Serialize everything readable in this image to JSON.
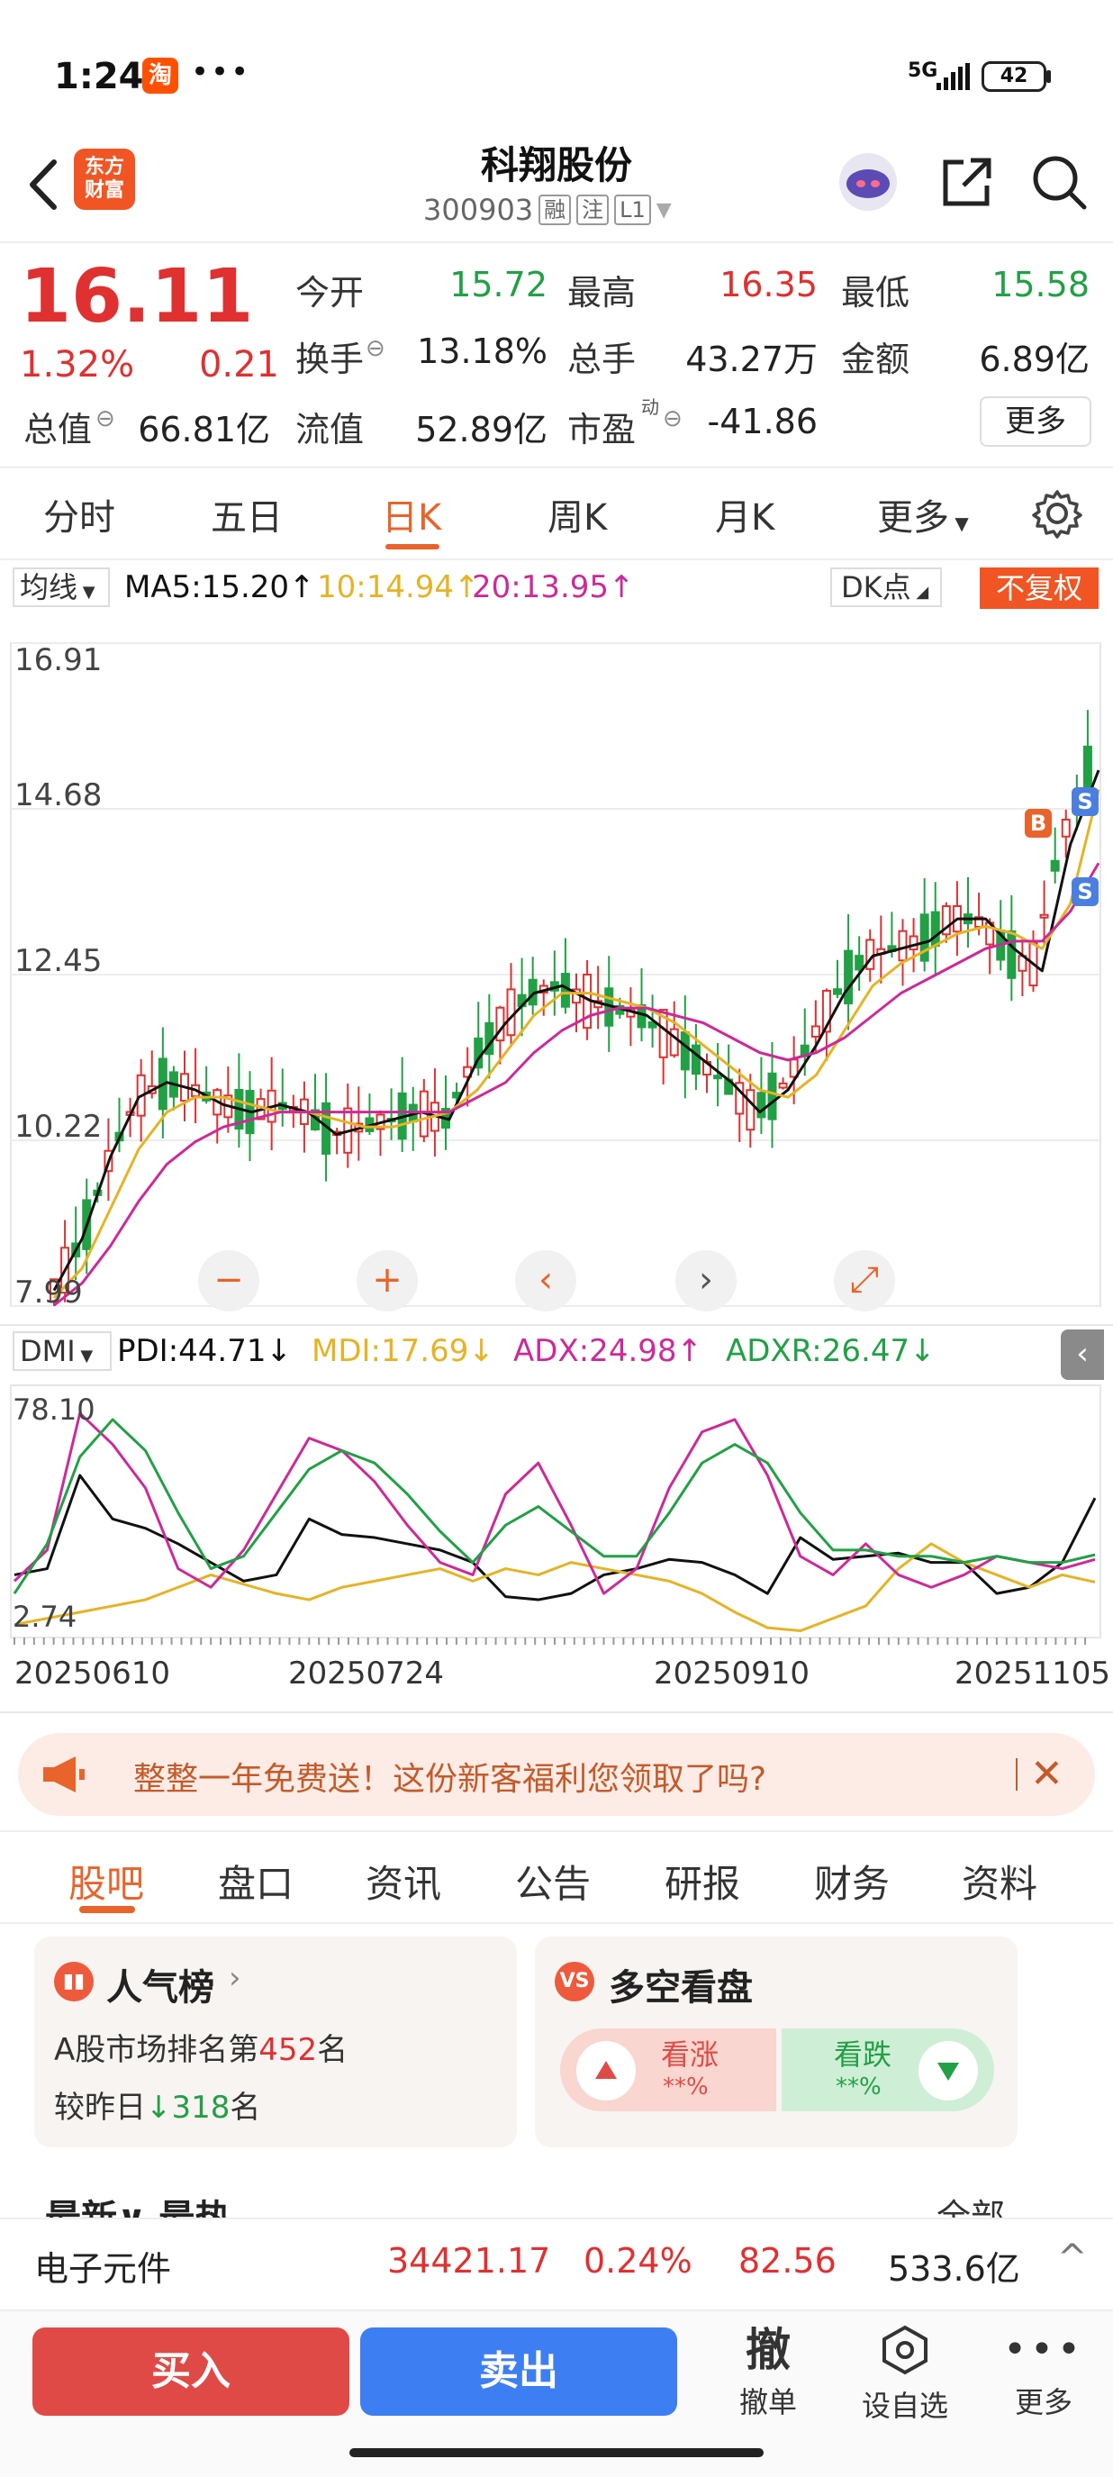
{
  "status_bar": {
    "time": "1:24",
    "app_badge": "淘",
    "dots": "•••",
    "network": "5G",
    "battery": "42"
  },
  "header": {
    "logo_line1": "东方",
    "logo_line2": "财富",
    "stock_name": "科翔股份",
    "stock_code": "300903",
    "tags": [
      "融",
      "注",
      "L1"
    ]
  },
  "quote": {
    "price": "16.11",
    "change_pct": "1.32%",
    "change_amt": "0.21",
    "open_label": "今开",
    "open": "15.72",
    "high_label": "最高",
    "high": "16.35",
    "low_label": "最低",
    "low": "15.58",
    "turnover_label": "换手",
    "turnover": "13.18%",
    "volume_label": "总手",
    "volume": "43.27万",
    "amount_label": "金额",
    "amount": "6.89亿",
    "mktcap_label": "总值",
    "mktcap": "66.81亿",
    "float_label": "流值",
    "float_cap": "52.89亿",
    "pe_label": "市盈",
    "pe_sup": "动",
    "pe": "-41.86",
    "more_label": "更多"
  },
  "period_tabs": [
    "分时",
    "五日",
    "日K",
    "周K",
    "月K",
    "更多"
  ],
  "period_active": "日K",
  "chart_header": {
    "ma_select": "均线",
    "ma5": "MA5:15.20↑",
    "ma10": "10:14.94↑",
    "ma20": "20:13.95↑",
    "dk": "DK点",
    "fq": "不复权"
  },
  "chart_controls": [
    "−",
    "+",
    "‹",
    "›",
    "⤢"
  ],
  "markers": {
    "buy": "B",
    "sell": "S"
  },
  "dmi_header": {
    "select": "DMI",
    "pdi": "PDI:44.71↓",
    "mdi": "MDI:17.69↓",
    "adx": "ADX:24.98↑",
    "adxr": "ADXR:26.47↓"
  },
  "dates": [
    "20250610",
    "20250724",
    "20250910",
    "20251105"
  ],
  "chart_data": [
    {
      "type": "candlestick",
      "ylim": [
        7.99,
        16.91
      ],
      "yticks": [
        "16.91",
        "14.68",
        "12.45",
        "10.22",
        "7.99"
      ],
      "series": [
        {
          "name": "MA5",
          "values": [
            8.2,
            8.9,
            10.0,
            10.8,
            11.0,
            10.9,
            10.7,
            10.6,
            10.7,
            10.6,
            10.3,
            10.4,
            10.5,
            10.6,
            10.5,
            11.3,
            11.8,
            12.2,
            12.3,
            12.1,
            12.0,
            11.9,
            11.6,
            11.3,
            11.0,
            10.6,
            10.9,
            11.5,
            12.2,
            12.7,
            12.8,
            12.9,
            13.2,
            13.2,
            12.8,
            12.5,
            14.2,
            15.2
          ]
        },
        {
          "name": "10",
          "values": [
            8.1,
            8.5,
            9.3,
            10.1,
            10.6,
            10.8,
            10.8,
            10.7,
            10.6,
            10.6,
            10.5,
            10.4,
            10.4,
            10.5,
            10.6,
            10.9,
            11.4,
            11.9,
            12.2,
            12.2,
            12.1,
            12.0,
            11.8,
            11.5,
            11.2,
            10.9,
            10.8,
            11.1,
            11.7,
            12.3,
            12.6,
            12.8,
            13.0,
            13.1,
            13.0,
            12.8,
            13.4,
            14.94
          ]
        },
        {
          "name": "20",
          "values": [
            8.0,
            8.3,
            8.8,
            9.4,
            9.9,
            10.2,
            10.4,
            10.5,
            10.6,
            10.6,
            10.6,
            10.6,
            10.6,
            10.6,
            10.6,
            10.8,
            11.0,
            11.4,
            11.7,
            11.9,
            12.0,
            12.0,
            11.9,
            11.8,
            11.6,
            11.4,
            11.3,
            11.4,
            11.6,
            11.9,
            12.2,
            12.4,
            12.6,
            12.8,
            12.9,
            12.9,
            13.3,
            13.95
          ]
        }
      ]
    },
    {
      "type": "line",
      "ylim": [
        2.74,
        78.1
      ],
      "yticks": [
        "78.10",
        "2.74"
      ],
      "series": [
        {
          "name": "PDI",
          "values": [
            20,
            22,
            52,
            38,
            35,
            30,
            24,
            18,
            20,
            38,
            33,
            32,
            30,
            28,
            24,
            13,
            12,
            14,
            20,
            22,
            25,
            24,
            20,
            14,
            32,
            25,
            26,
            27,
            24,
            24,
            14,
            16,
            24,
            44.71
          ]
        },
        {
          "name": "MDI",
          "values": [
            4,
            6,
            8,
            10,
            12,
            16,
            20,
            17,
            14,
            12,
            16,
            18,
            20,
            22,
            18,
            22,
            20,
            24,
            22,
            20,
            18,
            14,
            8,
            3,
            2,
            6,
            10,
            22,
            30,
            24,
            20,
            16,
            20,
            17.69
          ]
        },
        {
          "name": "ADX",
          "values": [
            18,
            28,
            72,
            62,
            48,
            22,
            16,
            28,
            46,
            64,
            60,
            50,
            36,
            24,
            20,
            46,
            56,
            36,
            14,
            22,
            48,
            66,
            70,
            52,
            26,
            20,
            30,
            20,
            16,
            20,
            26,
            24,
            22,
            24.98
          ]
        },
        {
          "name": "ADXR",
          "values": [
            14,
            30,
            58,
            70,
            60,
            40,
            22,
            26,
            40,
            54,
            60,
            56,
            46,
            34,
            24,
            36,
            42,
            34,
            26,
            26,
            40,
            56,
            62,
            56,
            40,
            28,
            28,
            26,
            26,
            24,
            26,
            24,
            24,
            26.47
          ]
        }
      ]
    }
  ],
  "promo": {
    "text": "整整一年免费送！这份新客福利您领取了吗?",
    "close": "✕"
  },
  "content_tabs": [
    "股吧",
    "盘口",
    "资讯",
    "公告",
    "研报",
    "财务",
    "资料"
  ],
  "popularity": {
    "title": "人气榜",
    "rank_prefix": "A股市场排名第",
    "rank": "452",
    "rank_suffix": "名",
    "delta_prefix": "较昨日",
    "delta_arrow": "↓",
    "delta": "318",
    "delta_suffix": "名"
  },
  "vote": {
    "title": "多空看盘",
    "bull_label": "看涨",
    "bull_value": "**%",
    "bear_label": "看跌",
    "bear_value": "**%"
  },
  "feed_peek": "最新∨  最热",
  "filter_peek": "全部",
  "index_bar": {
    "name": "电子元件",
    "value": "34421.17",
    "pct": "0.24%",
    "change": "82.56",
    "amount": "533.6亿",
    "caret": "^"
  },
  "bottom_bar": {
    "buy": "买入",
    "sell": "卖出",
    "cancel_glyph": "撤",
    "cancel_label": "撤单",
    "watch_label": "设自选",
    "more_label": "更多"
  },
  "colors": {
    "up": "#e03030",
    "down": "#22a045",
    "accent": "#e8642b",
    "ma10": "#e6b325",
    "ma20": "#cc2a99"
  }
}
